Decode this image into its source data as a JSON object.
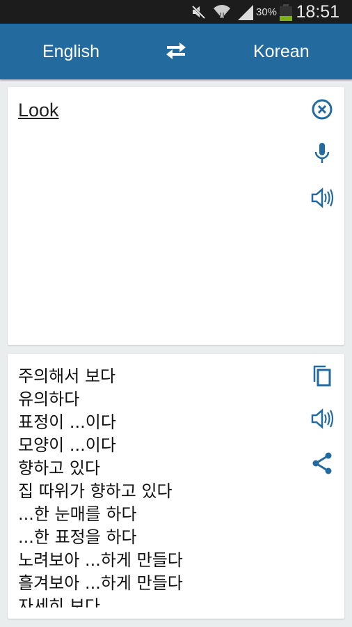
{
  "status_bar": {
    "battery_percent": "30%",
    "time": "18:51",
    "icons": [
      "mute-icon",
      "wifi-icon",
      "signal-icon",
      "battery-icon"
    ]
  },
  "header": {
    "source_language": "English",
    "target_language": "Korean",
    "swap_icon": "swap-arrows-icon"
  },
  "input": {
    "text": "Look",
    "icons": [
      "clear-icon",
      "microphone-icon",
      "speaker-icon"
    ]
  },
  "output": {
    "translations": [
      "주의해서 보다",
      "유의하다",
      "표정이 ...이다",
      "모양이 ...이다",
      "향하고 있다",
      "집 따위가 향하고 있다",
      "...한 눈매를 하다",
      "...한 표정을 하다",
      "노려보아 ...하게 만들다",
      "흘겨보아 ...하게 만들다",
      "자세히 보다"
    ],
    "icons": [
      "copy-icon",
      "speaker-icon",
      "share-icon"
    ]
  },
  "colors": {
    "accent": "#236a9f",
    "status_bar": "#1c1c1c",
    "background": "#e9eded"
  }
}
